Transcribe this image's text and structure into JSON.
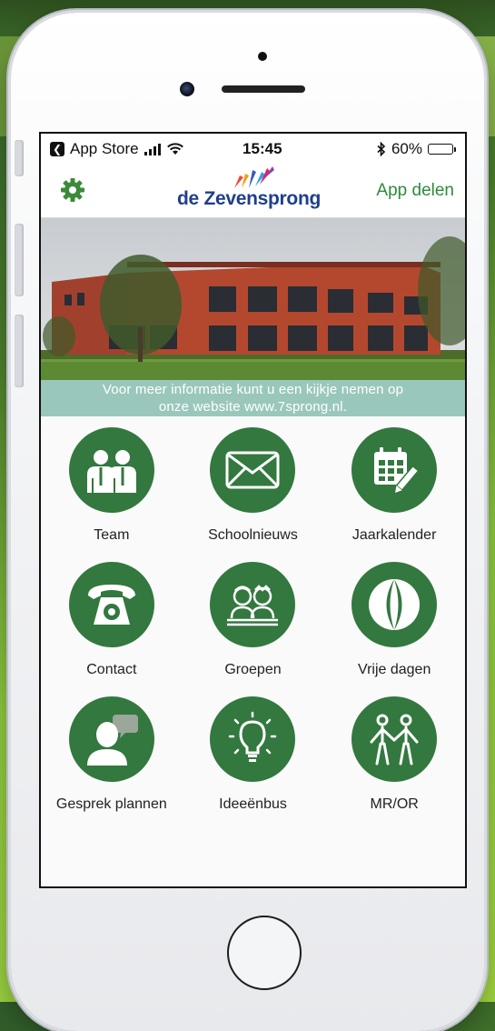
{
  "status_bar": {
    "back_app": "App Store",
    "time": "15:45",
    "battery": "60%",
    "battery_level": 0.6
  },
  "nav": {
    "logo_text": "de Zevensprong",
    "share_label": "App delen"
  },
  "hero": {
    "caption_line1": "Voor meer informatie kunt u een kijkje nemen op",
    "caption_line2": "onze website www.7sprong.nl."
  },
  "tiles": [
    {
      "label": "Team",
      "icon": "team-icon"
    },
    {
      "label": "Schoolnieuws",
      "icon": "envelope-icon"
    },
    {
      "label": "Jaarkalender",
      "icon": "calendar-icon"
    },
    {
      "label": "Contact",
      "icon": "telephone-icon"
    },
    {
      "label": "Groepen",
      "icon": "groups-icon"
    },
    {
      "label": "Vrije dagen",
      "icon": "beach-ball-icon"
    },
    {
      "label": "Gesprek plannen",
      "icon": "chat-person-icon"
    },
    {
      "label": "Ideeënbus",
      "icon": "lightbulb-icon"
    },
    {
      "label": "MR/OR",
      "icon": "people-holding-hands-icon"
    }
  ],
  "colors": {
    "accent_green": "#33783f",
    "link_green": "#2e8b3a",
    "logo_blue": "#1f3f8c"
  }
}
